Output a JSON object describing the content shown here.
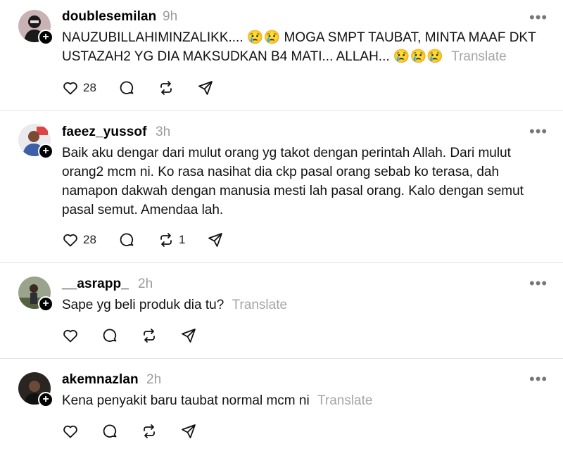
{
  "posts": [
    {
      "username": "doublesemilan",
      "time": "9h",
      "text": "NAUZUBILLAHIMINZALIKK.... 😢😢 MOGA SMPT TAUBAT, MINTA MAAF DKT USTAZAH2 YG DIA MAKSUDKAN B4 MATI... ALLAH... 😢😢😢",
      "translate": "Translate",
      "likes": "28",
      "reposts": "",
      "avatar_color": "#c9b2b4"
    },
    {
      "username": "faeez_yussof",
      "time": "3h",
      "text": "Baik aku dengar dari mulut orang yg takot dengan perintah Allah. Dari mulut orang2 mcm ni. Ko rasa nasihat dia ckp pasal orang sebab ko terasa, dah namapon dakwah dengan manusia mesti lah pasal orang. Kalo dengan semut pasal semut. Amendaa lah.",
      "translate": "",
      "likes": "28",
      "reposts": "1",
      "avatar_color": "#3c5fa8"
    },
    {
      "username": "__asrapp_",
      "time": "2h",
      "text": "Sape yg beli produk dia tu?",
      "translate": "Translate",
      "likes": "",
      "reposts": "",
      "avatar_color": "#6f7a5c"
    },
    {
      "username": "akemnazlan",
      "time": "2h",
      "text": "Kena penyakit baru taubat normal mcm ni",
      "translate": "Translate",
      "likes": "",
      "reposts": "",
      "avatar_color": "#2b2522"
    }
  ],
  "more_label": "•••"
}
